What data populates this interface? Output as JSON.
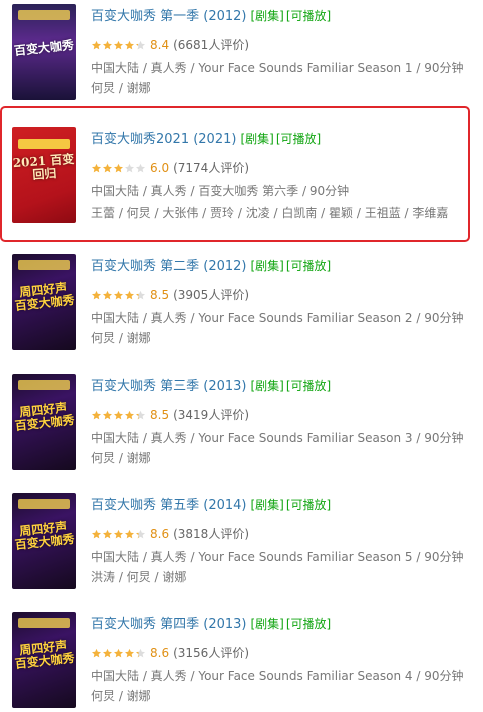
{
  "items": [
    {
      "title": "百变大咖秀 第一季 (2012)",
      "tag_episodes": "[剧集]",
      "tag_playable": "[可播放]",
      "rating_stars": 4.2,
      "score": "8.4",
      "votes": "(6681人评价)",
      "meta": "中国大陆 / 真人秀 / Your Face Sounds Familiar Season 1 / 90分钟",
      "cast": "何炅 / 谢娜",
      "poster_style": "show1",
      "poster_text": "百变大咖秀"
    },
    {
      "title": "百变大咖秀2021 (2021)",
      "tag_episodes": "[剧集]",
      "tag_playable": "[可播放]",
      "rating_stars": 3.0,
      "score": "6.0",
      "votes": "(7174人评价)",
      "meta": "中国大陆 / 真人秀 / 百变大咖秀 第六季 / 90分钟",
      "cast": "王蕾 / 何炅 / 大张伟 / 贾玲 / 沈凌 / 白凯南 / 瞿颖 / 王祖蓝 / 李维嘉",
      "poster_style": "red",
      "poster_text": "2021 百变回归",
      "highlighted": true
    },
    {
      "title": "百变大咖秀 第二季 (2012)",
      "tag_episodes": "[剧集]",
      "tag_playable": "[可播放]",
      "rating_stars": 4.25,
      "score": "8.5",
      "votes": "(3905人评价)",
      "meta": "中国大陆 / 真人秀 / Your Face Sounds Familiar Season 2 / 90分钟",
      "cast": "何炅 / 谢娜",
      "poster_style": "purple",
      "poster_text": "周四好声 百变大咖秀"
    },
    {
      "title": "百变大咖秀 第三季 (2013)",
      "tag_episodes": "[剧集]",
      "tag_playable": "[可播放]",
      "rating_stars": 4.25,
      "score": "8.5",
      "votes": "(3419人评价)",
      "meta": "中国大陆 / 真人秀 / Your Face Sounds Familiar Season 3 / 90分钟",
      "cast": "何炅 / 谢娜",
      "poster_style": "purple",
      "poster_text": "周四好声 百变大咖秀"
    },
    {
      "title": "百变大咖秀 第五季 (2014)",
      "tag_episodes": "[剧集]",
      "tag_playable": "[可播放]",
      "rating_stars": 4.3,
      "score": "8.6",
      "votes": "(3818人评价)",
      "meta": "中国大陆 / 真人秀 / Your Face Sounds Familiar Season 5 / 90分钟",
      "cast": "洪涛 / 何炅 / 谢娜",
      "poster_style": "purple",
      "poster_text": "周四好声 百变大咖秀"
    },
    {
      "title": "百变大咖秀 第四季 (2013)",
      "tag_episodes": "[剧集]",
      "tag_playable": "[可播放]",
      "rating_stars": 4.3,
      "score": "8.6",
      "votes": "(3156人评价)",
      "meta": "中国大陆 / 真人秀 / Your Face Sounds Familiar Season 4 / 90分钟",
      "cast": "何炅 / 谢娜",
      "poster_style": "purple",
      "poster_text": "周四好声 百变大咖秀"
    }
  ],
  "colors": {
    "title": "#3377aa",
    "tag": "#11a511",
    "score": "#e09015",
    "star_filled": "#f4b23b",
    "star_empty": "#dddddd",
    "highlight_border": "#e0262b"
  }
}
